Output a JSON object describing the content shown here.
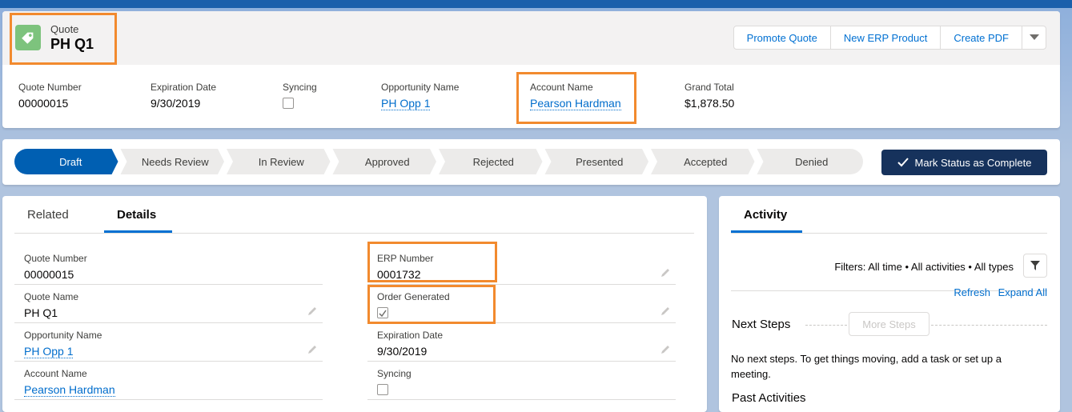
{
  "header": {
    "object_type": "Quote",
    "record_name": "PH Q1",
    "actions": [
      "Promote Quote",
      "New ERP Product",
      "Create PDF"
    ],
    "fields": [
      {
        "label": "Quote Number",
        "value": "00000015"
      },
      {
        "label": "Expiration Date",
        "value": "9/30/2019"
      },
      {
        "label": "Syncing",
        "value": ""
      },
      {
        "label": "Opportunity Name",
        "value": "PH Opp 1"
      },
      {
        "label": "Account Name",
        "value": "Pearson Hardman"
      },
      {
        "label": "Grand Total",
        "value": "$1,878.50"
      }
    ]
  },
  "path": {
    "stages": [
      "Draft",
      "Needs Review",
      "In Review",
      "Approved",
      "Rejected",
      "Presented",
      "Accepted",
      "Denied"
    ],
    "current": "Draft",
    "mark_button": "Mark Status as Complete",
    "colors": {
      "active": "#005fb2",
      "inactive": "#ecebea",
      "button": "#16325c"
    }
  },
  "details": {
    "tabs": [
      "Related",
      "Details"
    ],
    "active_tab": "Details",
    "left_fields": [
      {
        "label": "Quote Number",
        "value": "00000015"
      },
      {
        "label": "Quote Name",
        "value": "PH Q1"
      },
      {
        "label": "Opportunity Name",
        "value": "PH Opp 1"
      },
      {
        "label": "Account Name",
        "value": "Pearson Hardman"
      }
    ],
    "right_fields": [
      {
        "label": "ERP Number",
        "value": "0001732"
      },
      {
        "label": "Order Generated",
        "value": "",
        "checked": true
      },
      {
        "label": "Expiration Date",
        "value": "9/30/2019"
      },
      {
        "label": "Syncing",
        "value": "",
        "checked": false
      }
    ]
  },
  "activity": {
    "tab": "Activity",
    "filters_text": "Filters: All time • All activities • All types",
    "refresh": "Refresh",
    "expand_all": "Expand All",
    "next_steps": "Next Steps",
    "more_steps": "More Steps",
    "no_steps": "No next steps. To get things moving, add a task or set up a meeting.",
    "past_activities": "Past Activities"
  },
  "accent_color": "#f28a2e"
}
